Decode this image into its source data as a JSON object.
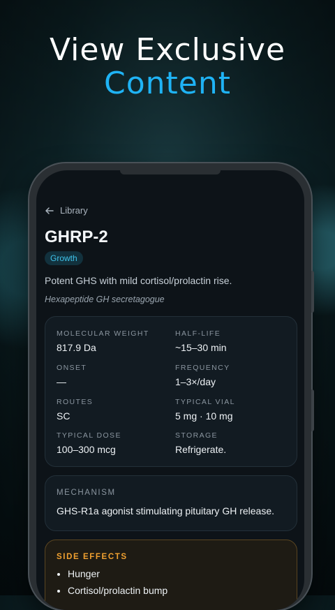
{
  "headline": {
    "line1": "View Exclusive",
    "line2": "Content"
  },
  "nav": {
    "back_label": "Library"
  },
  "peptide": {
    "name": "GHRP-2",
    "category": "Growth",
    "summary": "Potent GHS with mild cortisol/prolactin rise.",
    "classification": "Hexapeptide GH secretagogue"
  },
  "stats": [
    {
      "label": "MOLECULAR WEIGHT",
      "value": "817.9 Da"
    },
    {
      "label": "HALF-LIFE",
      "value": "~15–30 min"
    },
    {
      "label": "ONSET",
      "value": "—"
    },
    {
      "label": "FREQUENCY",
      "value": "1–3×/day"
    },
    {
      "label": "ROUTES",
      "value": "SC"
    },
    {
      "label": "TYPICAL VIAL",
      "value": "5 mg · 10 mg"
    },
    {
      "label": "TYPICAL DOSE",
      "value": "100–300 mcg"
    },
    {
      "label": "STORAGE",
      "value": "Refrigerate."
    }
  ],
  "mechanism": {
    "label": "MECHANISM",
    "text": "GHS-R1a agonist stimulating pituitary GH release."
  },
  "side_effects": {
    "label": "SIDE EFFECTS",
    "items": [
      "Hunger",
      "Cortisol/prolactin bump"
    ]
  },
  "colors": {
    "accent": "#1fb3f5",
    "tag_text": "#3fc3ea",
    "warning": "#f0a030",
    "screen_bg": "#0d1318"
  }
}
